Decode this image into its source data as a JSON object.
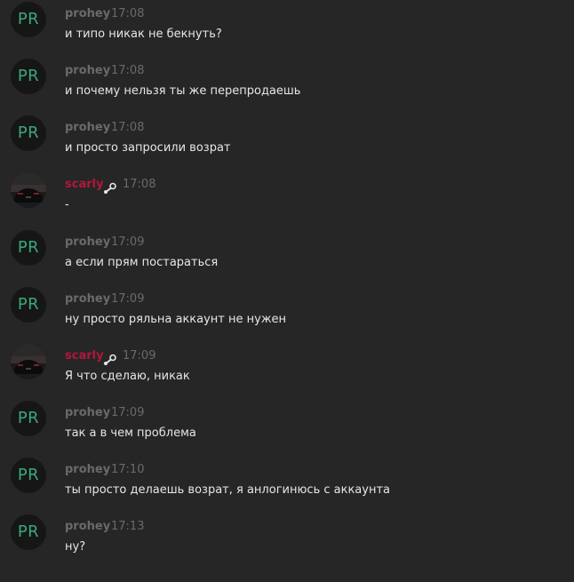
{
  "colors": {
    "background": "#262626",
    "username_default": "#6a6a6a",
    "username_scarly": "#b3163c",
    "avatar_initials": "#3aa87a",
    "message_text": "#e6e6e6"
  },
  "icons": {
    "badge": "steam-icon"
  },
  "messages": [
    {
      "avatar": "PR",
      "author": "prohey",
      "time": "17:08",
      "text": "и типо никак не бекнуть?"
    },
    {
      "avatar": "PR",
      "author": "prohey",
      "time": "17:08",
      "text": "и почему нельзя ты же перепродаешь"
    },
    {
      "avatar": "PR",
      "author": "prohey",
      "time": "17:08",
      "text": "и просто запросили возрат"
    },
    {
      "avatar": "photo",
      "author": "scarly",
      "time": "17:08",
      "text": "-"
    },
    {
      "avatar": "PR",
      "author": "prohey",
      "time": "17:09",
      "text": "а если прям постараться"
    },
    {
      "avatar": "PR",
      "author": "prohey",
      "time": "17:09",
      "text": "ну просто ряльна аккаунт не нужен"
    },
    {
      "avatar": "photo",
      "author": "scarly",
      "time": "17:09",
      "text": "Я что сделаю, никак"
    },
    {
      "avatar": "PR",
      "author": "prohey",
      "time": "17:09",
      "text": "так а в чем проблема"
    },
    {
      "avatar": "PR",
      "author": "prohey",
      "time": "17:10",
      "text": "ты просто делаешь возрат, я анлогинюсь с аккаунта"
    },
    {
      "avatar": "PR",
      "author": "prohey",
      "time": "17:13",
      "text": "ну?"
    }
  ]
}
